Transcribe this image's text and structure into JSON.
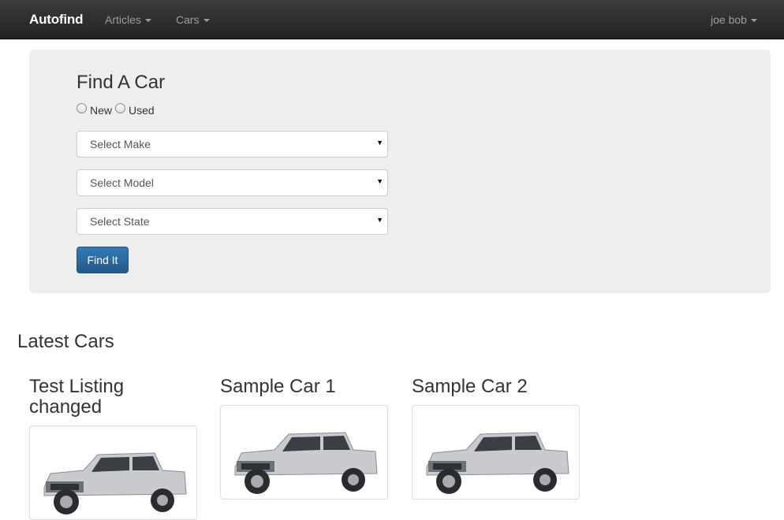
{
  "navbar": {
    "brand": "Autofind",
    "items": [
      {
        "label": "Articles"
      },
      {
        "label": "Cars"
      }
    ],
    "user": "joe bob"
  },
  "search": {
    "title": "Find A Car",
    "radio_new": "New",
    "radio_used": "Used",
    "make_selected": "Select Make",
    "model_selected": "Select Model",
    "state_selected": "Select State",
    "submit_label": "Find It"
  },
  "latest": {
    "heading": "Latest Cars",
    "cars": [
      {
        "title": "Test Listing changed",
        "image": "silver-pickup-truck"
      },
      {
        "title": "Sample Car 1",
        "image": "silver-pickup-truck"
      },
      {
        "title": "Sample Car 2",
        "image": "silver-pickup-truck"
      }
    ]
  },
  "colors": {
    "navbar_bg": "#222222",
    "jumbotron_bg": "#eeeeee",
    "primary": "#337ab7"
  }
}
